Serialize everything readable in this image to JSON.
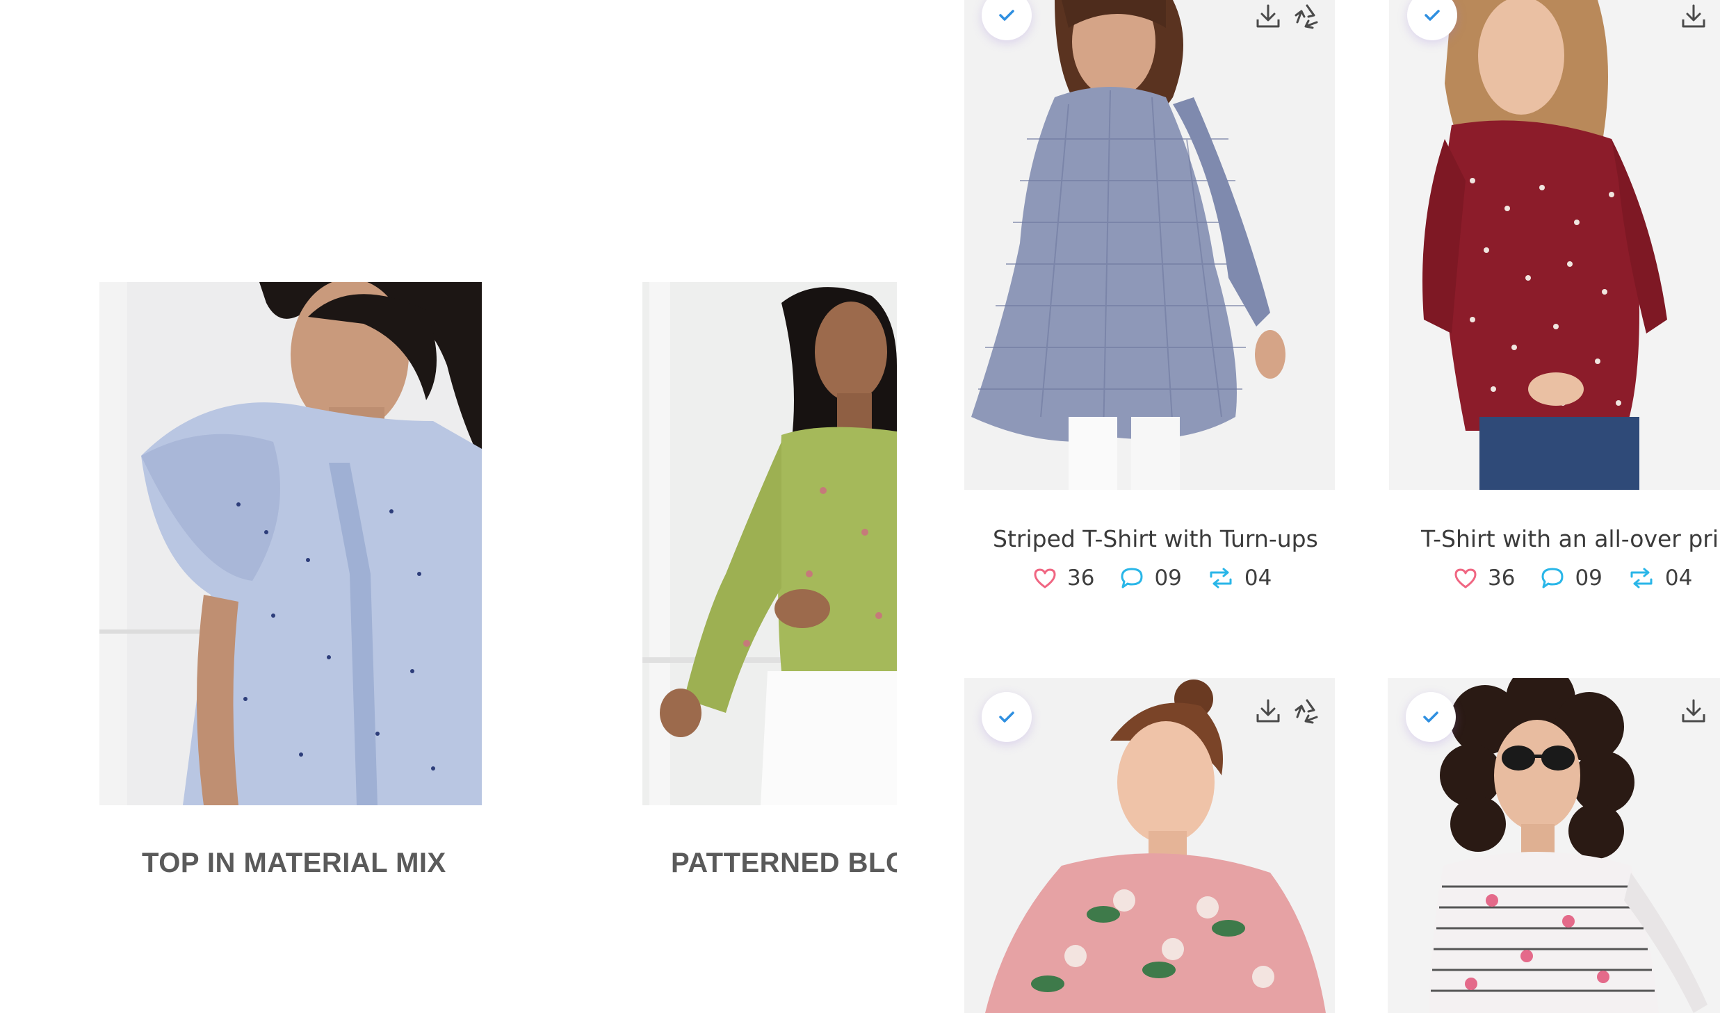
{
  "featured": [
    {
      "title": "TOP IN MATERIAL MIX",
      "image": "woman in light blue ruffled polka-dot top"
    },
    {
      "title": "PATTERNED BLC",
      "image": "woman in green floral blouse with white jeans"
    }
  ],
  "cards": [
    {
      "title": "Striped T-Shirt with Turn-ups",
      "likes": "36",
      "comments": "09",
      "shares": "04",
      "image": "woman in blue gingham asymmetric tunic"
    },
    {
      "title": "T-Shirt with an all-over print",
      "likes": "36",
      "comments": "09",
      "shares": "04",
      "image": "woman in maroon printed blouse with jeans"
    },
    {
      "title": "",
      "likes": "",
      "comments": "",
      "shares": "",
      "image": "woman in pink floral top"
    },
    {
      "title": "",
      "likes": "",
      "comments": "",
      "shares": "",
      "image": "woman in striped floral top with sunglasses"
    }
  ],
  "icons": {
    "check": "check-icon",
    "download": "download-icon",
    "recycle": "recycle-icon",
    "like": "heart-icon",
    "comment": "comment-icon",
    "share": "repost-icon"
  },
  "colors": {
    "check": "#2f8fe0",
    "like": "#f06682",
    "comment": "#29b6e8",
    "share": "#29b6e8",
    "tool_icon": "#4a4a4a",
    "featured_title": "#5a5a5a"
  }
}
